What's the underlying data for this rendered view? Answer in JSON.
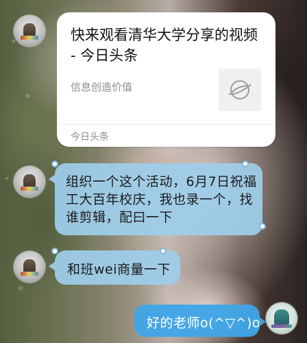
{
  "card": {
    "title": "快来观看清华大学分享的视频 - 今日头条",
    "description": "信息创造价值",
    "thumbnail_icon": "planet-icon",
    "source": "今日头条"
  },
  "messages": [
    {
      "side": "left",
      "text": "组织一个这个活动，6月7日祝福工大百年校庆，我也录一个，找谁剪辑，配曰一下"
    },
    {
      "side": "left",
      "text": "和班wei商量一下"
    },
    {
      "side": "right",
      "text": "好的老师o(^▽^)o"
    }
  ],
  "colors": {
    "incoming_bubble": "#9ecdeb",
    "outgoing_bubble": "#3fa5e8",
    "card_background": "#ffffff"
  }
}
